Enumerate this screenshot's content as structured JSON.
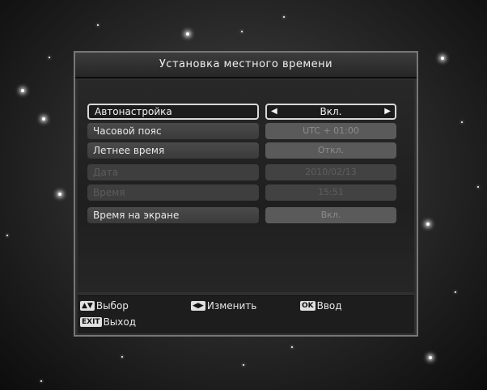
{
  "dialog": {
    "title": "Установка местного времени"
  },
  "settings": [
    {
      "label": "Автонастройка",
      "value": "Вкл."
    },
    {
      "label": "Часовой пояс",
      "value": "UTC + 01:00"
    },
    {
      "label": "Летнее время",
      "value": "Откл."
    },
    {
      "label": "Дата",
      "value": "2010/02/13"
    },
    {
      "label": "Время",
      "value": "15:51"
    },
    {
      "label": "Время на экране",
      "value": "Вкл."
    }
  ],
  "footer": {
    "select_label": "Выбор",
    "change_label": "Изменить",
    "ok_key": "OK",
    "enter_label": "Ввод",
    "exit_key": "EXIT",
    "exit_label": "Выход"
  }
}
